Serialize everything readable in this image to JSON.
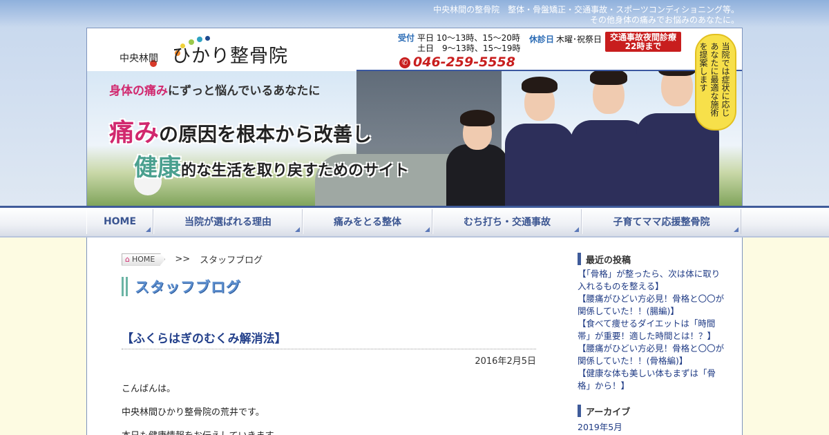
{
  "header": {
    "tagline_line1": "中央林間の整骨院　整体・骨盤矯正・交通事故・スポーツコンディショニング等。",
    "tagline_line2": "その他身体の痛みでお悩みのあなたに。",
    "logo_small": "中央林間",
    "logo_big": "ひかり整骨院",
    "reception_label": "受付",
    "hours_weekday": "平日 10～13時、15～20時",
    "hours_saturday": "土日　9～13時、15～19時",
    "closed_label": "休診日",
    "closed_days": "木曜･祝祭日",
    "night_line1": "交通事故夜間診療",
    "night_line2": "22時まで",
    "phone": "046-259-5558"
  },
  "hero": {
    "line1_pink": "身体の痛み",
    "line1_rest": "にずっと悩んでいるあなたに",
    "line2_big": "痛み",
    "line2_rest": "の原因を根本から改善し",
    "line3_big": "健康",
    "line3_rest": "的な生活を取り戻すためのサイト",
    "bubble": "当院では症状に応じあなたに最適な施術を提案します"
  },
  "nav": {
    "items": [
      {
        "label": "HOME"
      },
      {
        "label": "当院が選ばれる理由"
      },
      {
        "label": "痛みをとる整体"
      },
      {
        "label": "むち打ち・交通事故"
      },
      {
        "label": "子育てママ応援整骨院"
      }
    ]
  },
  "breadcrumb": {
    "home": "HOME",
    "separator": ">>",
    "current": "スタッフブログ"
  },
  "main": {
    "section_title": "スタッフブログ",
    "post_title": "【ふくらはぎのむくみ解消法】",
    "post_date": "2016年2月5日",
    "para1": "こんばんは。",
    "para2": "中央林間ひかり整骨院の荒井です。",
    "para3": "本日も健康情報をお伝えしていきます。"
  },
  "sidebar": {
    "recent_heading": "最近の投稿",
    "recent_posts": [
      "【「骨格」が整ったら、次は体に取り入れるものを整える】",
      "【腰痛がひどい方必見！骨格と〇〇が関係していた！！(腸編)】",
      "【食べて痩せるダイエットは「時間帯」が重要！適した時間とは！？】",
      "【腰痛がひどい方必見！骨格と〇〇が関係していた！！(骨格編)】",
      "【健康な体も美しい体もまずは「骨格」から！】"
    ],
    "archive_heading": "アーカイブ",
    "archive_items": [
      "2019年5月"
    ]
  }
}
